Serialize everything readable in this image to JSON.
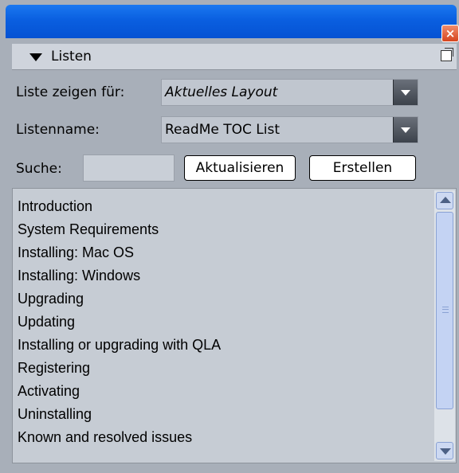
{
  "titlebar": {
    "close_icon": "close-icon"
  },
  "section": {
    "title": "Listen",
    "collapse_icon": "triangle-down-icon",
    "detach_icon": "detach-palette-icon"
  },
  "form": {
    "show_for_label": "Liste zeigen für:",
    "show_for_value": "Aktuelles Layout",
    "list_name_label": "Listenname:",
    "list_name_value": "ReadMe TOC List",
    "search_label": "Suche:",
    "search_value": "",
    "update_button": "Aktualisieren",
    "create_button": "Erstellen"
  },
  "list": {
    "items": [
      "Introduction",
      "System Requirements",
      "Installing: Mac OS",
      "Installing: Windows",
      "Upgrading",
      "Updating",
      "Installing or upgrading with QLA",
      "Registering",
      "Activating",
      "Uninstalling",
      "Known and resolved issues"
    ]
  },
  "colors": {
    "titlebar": "#0a5fe0",
    "panel": "#a8afb9",
    "list_bg": "#c6ccd4"
  }
}
